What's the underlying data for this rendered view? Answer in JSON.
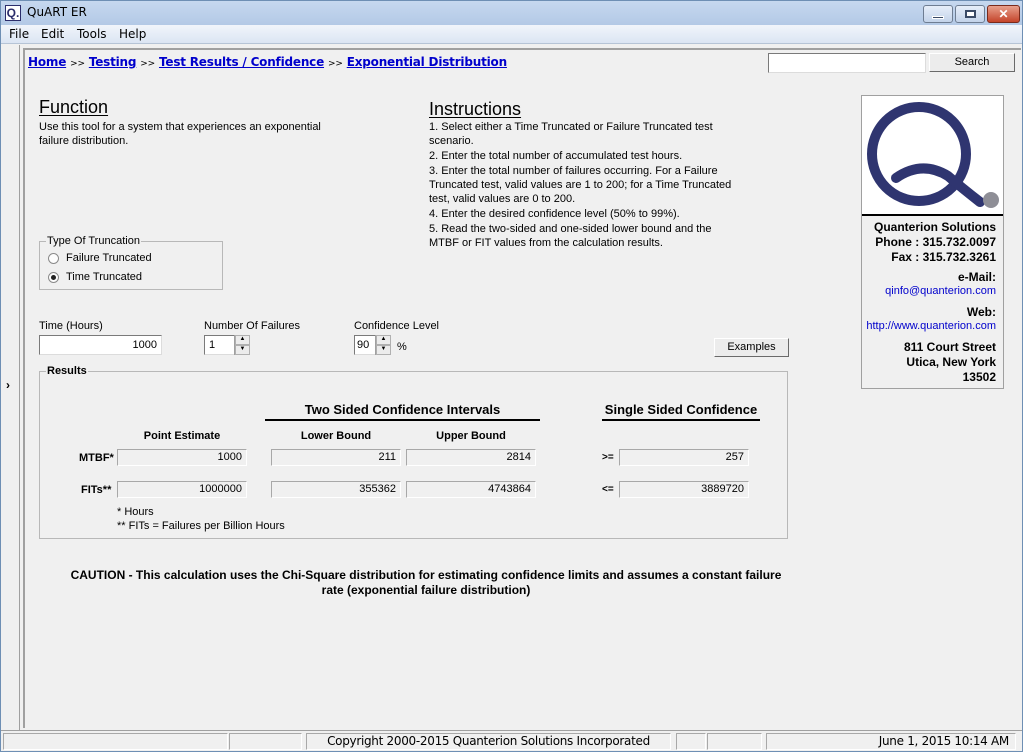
{
  "window": {
    "title": "QuART ER",
    "app_icon": "Q.",
    "controls": {
      "minimize": "minimize",
      "maximize": "maximize",
      "close": "✕"
    }
  },
  "menu": [
    "File",
    "Edit",
    "Tools",
    "Help"
  ],
  "left_toggle": "›",
  "breadcrumb": {
    "items": [
      "Home",
      "Testing",
      "Test Results / Confidence",
      "Exponential Distribution"
    ],
    "separator": ">>"
  },
  "search": {
    "value": "",
    "placeholder": "",
    "button": "Search"
  },
  "function": {
    "title": "Function",
    "text": "Use this tool for a system that experiences an exponential failure distribution."
  },
  "instructions": {
    "title": "Instructions",
    "steps": [
      "1. Select either a Time Truncated or Failure Truncated test scenario.",
      "2. Enter the total number of accumulated test hours.",
      "3. Enter the total number of failures occurring. For a Failure Truncated test, valid values are 1 to 200; for a Time Truncated test, valid values are 0 to 200.",
      "4. Enter the desired confidence level (50% to 99%).",
      "5. Read the two-sided and one-sided lower bound and the MTBF or FIT values from the calculation results."
    ]
  },
  "truncation": {
    "legend": "Type Of Truncation",
    "options": [
      {
        "label": "Failure Truncated",
        "selected": false
      },
      {
        "label": "Time Truncated",
        "selected": true
      }
    ]
  },
  "inputs": {
    "time_label": "Time (Hours)",
    "time_value": "1000",
    "failures_label": "Number Of Failures",
    "failures_value": "1",
    "confidence_label": "Confidence Level",
    "confidence_value": "90",
    "confidence_unit": "%"
  },
  "examples_button": "Examples",
  "results": {
    "legend": "Results",
    "two_sided_header": "Two Sided Confidence Intervals",
    "single_sided_header": "Single Sided Confidence",
    "columns": {
      "point_estimate": "Point Estimate",
      "lower_bound": "Lower Bound",
      "upper_bound": "Upper Bound"
    },
    "rows": [
      {
        "label": "MTBF*",
        "point": "1000",
        "lower": "211",
        "upper": "2814",
        "single_op": ">=",
        "single": "257"
      },
      {
        "label": "FITs**",
        "point": "1000000",
        "lower": "355362",
        "upper": "4743864",
        "single_op": "<=",
        "single": "3889720"
      }
    ],
    "footnotes": [
      "* Hours",
      "** FITs = Failures per Billion Hours"
    ]
  },
  "caution": "CAUTION - This calculation uses the Chi-Square distribution for estimating confidence limits and assumes a constant failure rate (exponential failure distribution)",
  "company": {
    "name": "Quanterion Solutions",
    "phone": "Phone : 315.732.0097",
    "fax": "Fax : 315.732.3261",
    "email_label": "e-Mail:",
    "email": "qinfo@quanterion.com",
    "web_label": "Web:",
    "web": "http://www.quanterion.com",
    "street": "811 Court Street",
    "city": "Utica, New York",
    "zip": "13502",
    "colors": {
      "logo_q": "#2f3570",
      "logo_dot": "#8e8e96"
    }
  },
  "statusbar": {
    "copyright": "Copyright 2000-2015 Quanterion Solutions Incorporated",
    "datetime": "June 1, 2015  10:14 AM"
  }
}
